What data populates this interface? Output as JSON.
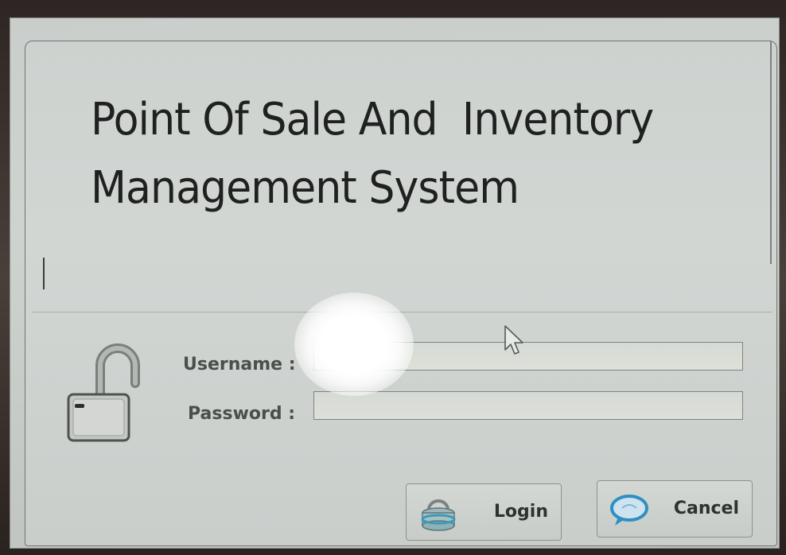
{
  "window": {
    "title_line1": "Point Of Sale And  Inventory",
    "title_line2": "Management System"
  },
  "login_form": {
    "username_label": "Username :",
    "password_label": "Password :",
    "username_value": "",
    "password_value": ""
  },
  "buttons": {
    "login_label": "Login",
    "cancel_label": "Cancel"
  },
  "icons": {
    "lock": "unlocked-padlock-icon",
    "login": "database-login-icon",
    "cancel": "speech-bubble-cancel-icon",
    "cursor": "mouse-pointer-icon"
  },
  "colors": {
    "background": "#cdd2cf",
    "title_text": "#1f2120",
    "label_text": "#4a4f4d",
    "cancel_icon_accent": "#2f8fc4",
    "login_icon_accent": "#3a9ab8"
  }
}
